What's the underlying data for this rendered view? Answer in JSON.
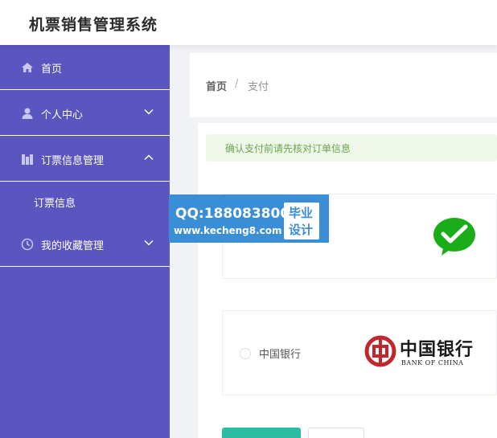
{
  "app": {
    "title": "机票销售管理系统"
  },
  "sidebar": {
    "items": [
      {
        "label": "首页",
        "icon": "home-icon"
      },
      {
        "label": "个人中心",
        "icon": "user-icon"
      },
      {
        "label": "订票信息管理",
        "icon": "ticket-icon"
      },
      {
        "label": "我的收藏管理",
        "icon": "clock-icon"
      }
    ],
    "subitems": [
      {
        "label": "订票信息"
      }
    ]
  },
  "breadcrumb": {
    "home": "首页",
    "separator": "/",
    "current": "支付"
  },
  "alert": {
    "text": "确认支付前请先核对订单信息"
  },
  "payment": {
    "wechat": {
      "icon": "wechat-pay-icon"
    },
    "boc": {
      "label": "中国银行",
      "logo_cn": "中国银行",
      "logo_en": "BANK OF CHINA",
      "icon": "bank-of-china-icon"
    }
  },
  "watermark": {
    "qq": "QQ:188083800",
    "site": "www.kecheng8.com",
    "badge_line1": "毕业",
    "badge_line2": "设计"
  },
  "colors": {
    "sidebar": "#5b55c0",
    "primary": "#2bbda4",
    "alert_bg": "#eef7ea",
    "alert_text": "#67a64b",
    "watermark": "#3a8ed6"
  }
}
